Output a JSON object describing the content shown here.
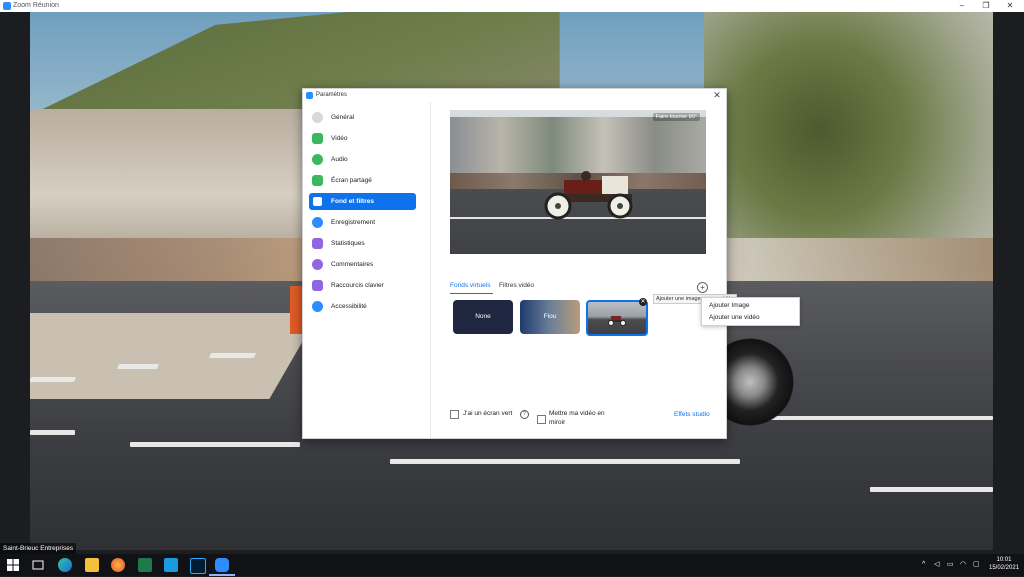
{
  "window": {
    "title": "Zoom Réunion"
  },
  "settings": {
    "title": "Paramètres",
    "nav": [
      {
        "label": "Général",
        "color": "#d0d0d0"
      },
      {
        "label": "Vidéo",
        "color": "#3bb75e"
      },
      {
        "label": "Audio",
        "color": "#3bb75e"
      },
      {
        "label": "Écran partagé",
        "color": "#3bb75e"
      },
      {
        "label": "Fond et filtres",
        "color": "#ffffff",
        "active": true
      },
      {
        "label": "Enregistrement",
        "color": "#2d8cff"
      },
      {
        "label": "Statistiques",
        "color": "#8e67e0"
      },
      {
        "label": "Commentaires",
        "color": "#8e67e0"
      },
      {
        "label": "Raccourcis clavier",
        "color": "#8e67e0"
      },
      {
        "label": "Accessibilité",
        "color": "#2d8cff"
      }
    ],
    "preview": {
      "rotate_label": "Faire tourner 90°"
    },
    "tabs": {
      "virtual": "Fonds virtuels",
      "filters": "Filtres vidéo"
    },
    "add_tooltip": "Ajouter une image ou une vidéo",
    "backgrounds": {
      "none": "None",
      "blur": "Flou"
    },
    "green_screen_label": "J'ai un écran vert",
    "mirror_label_1": "Mettre ma vidéo en",
    "mirror_label_2": "miroir",
    "studio_effects": "Effets studio"
  },
  "context_menu": {
    "items": [
      "Ajouter Image",
      "Ajouter une vidéo"
    ]
  },
  "participant_name": "Saint-Brieuc Entreprises",
  "clock": {
    "time": "10:01",
    "date": "15/02/2021"
  },
  "accent_color": "#0e72ed"
}
